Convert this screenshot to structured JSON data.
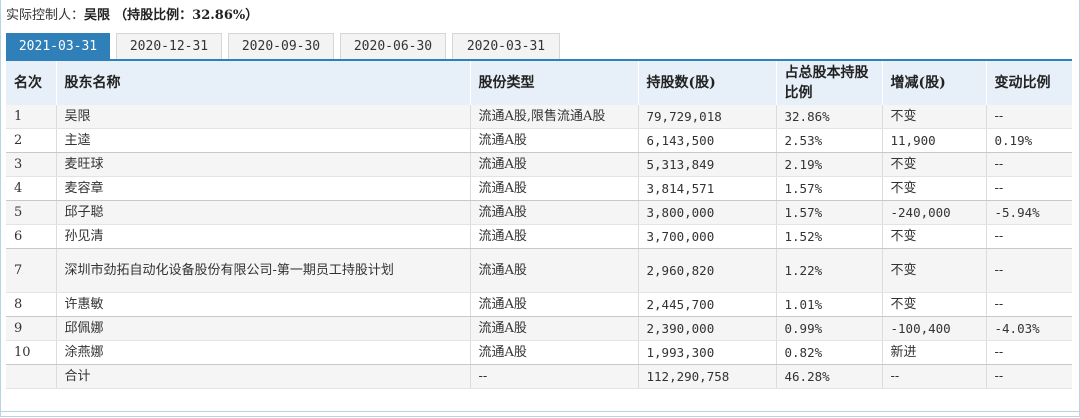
{
  "controller": {
    "label": "实际控制人：",
    "name": "吴限",
    "ratio_text": "（持股比例：32.86%）"
  },
  "tabs": [
    "2021-03-31",
    "2020-12-31",
    "2020-09-30",
    "2020-06-30",
    "2020-03-31"
  ],
  "active_tab": 0,
  "columns": [
    "名次",
    "股东名称",
    "股份类型",
    "持股数(股)",
    "占总股本持股比例",
    "增减(股)",
    "变动比例"
  ],
  "rows": [
    {
      "rank": "1",
      "name": "吴限",
      "type": "流通A股,限售流通A股",
      "shares": "79,729,018",
      "ratio": "32.86%",
      "change": "不变",
      "change_pct": "--"
    },
    {
      "rank": "2",
      "name": "主逵",
      "type": "流通A股",
      "shares": "6,143,500",
      "ratio": "2.53%",
      "change": "11,900",
      "change_pct": "0.19%"
    },
    {
      "rank": "3",
      "name": "麦旺球",
      "type": "流通A股",
      "shares": "5,313,849",
      "ratio": "2.19%",
      "change": "不变",
      "change_pct": "--"
    },
    {
      "rank": "4",
      "name": "麦容章",
      "type": "流通A股",
      "shares": "3,814,571",
      "ratio": "1.57%",
      "change": "不变",
      "change_pct": "--"
    },
    {
      "rank": "5",
      "name": "邱子聪",
      "type": "流通A股",
      "shares": "3,800,000",
      "ratio": "1.57%",
      "change": "-240,000",
      "change_pct": "-5.94%"
    },
    {
      "rank": "6",
      "name": "孙见清",
      "type": "流通A股",
      "shares": "3,700,000",
      "ratio": "1.52%",
      "change": "不变",
      "change_pct": "--"
    },
    {
      "rank": "7",
      "name": "深圳市劲拓自动化设备股份有限公司-第一期员工持股计划",
      "type": "流通A股",
      "shares": "2,960,820",
      "ratio": "1.22%",
      "change": "不变",
      "change_pct": "--"
    },
    {
      "rank": "8",
      "name": "许惠敏",
      "type": "流通A股",
      "shares": "2,445,700",
      "ratio": "1.01%",
      "change": "不变",
      "change_pct": "--"
    },
    {
      "rank": "9",
      "name": "邱佩娜",
      "type": "流通A股",
      "shares": "2,390,000",
      "ratio": "0.99%",
      "change": "-100,400",
      "change_pct": "-4.03%"
    },
    {
      "rank": "10",
      "name": "涂燕娜",
      "type": "流通A股",
      "shares": "1,993,300",
      "ratio": "0.82%",
      "change": "新进",
      "change_pct": "--"
    }
  ],
  "total": {
    "rank": "",
    "name": "合计",
    "type": "--",
    "shares": "112,290,758",
    "ratio": "46.28%",
    "change": "--",
    "change_pct": "--"
  },
  "colors": {
    "accent": "#2f7fb8",
    "header_bg": "#e7f0f8",
    "border": "#b7d3e4"
  }
}
